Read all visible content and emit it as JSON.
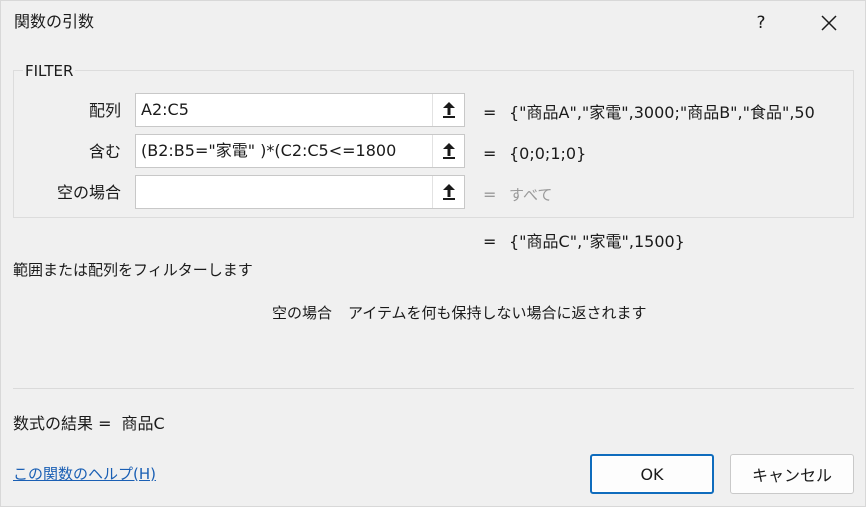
{
  "window": {
    "title": "関数の引数",
    "help_button": "?",
    "close_icon": "close-icon"
  },
  "function_name": "FILTER",
  "arguments": [
    {
      "label": "配列",
      "value": "A2:C5",
      "result": "{\"商品A\",\"家電\",3000;\"商品B\",\"食品\",50",
      "result_muted": false
    },
    {
      "label": "含む",
      "value": "(B2:B5=\"家電\" )*(C2:C5<=1800",
      "result": "{0;0;1;0}",
      "result_muted": false
    },
    {
      "label": "空の場合",
      "value": "",
      "result": "すべて",
      "result_muted": true
    }
  ],
  "equals_sign": "=",
  "function_result": "{\"商品C\",\"家電\",1500}",
  "function_description": "範囲または配列をフィルターします",
  "parameter_help": {
    "name": "空の場合",
    "text": "アイテムを何も保持しない場合に返されます"
  },
  "formula_result": {
    "label": "数式の結果 =",
    "value": "商品C"
  },
  "help_link": "この関数のヘルプ(H)",
  "buttons": {
    "ok": "OK",
    "cancel": "キャンセル"
  }
}
